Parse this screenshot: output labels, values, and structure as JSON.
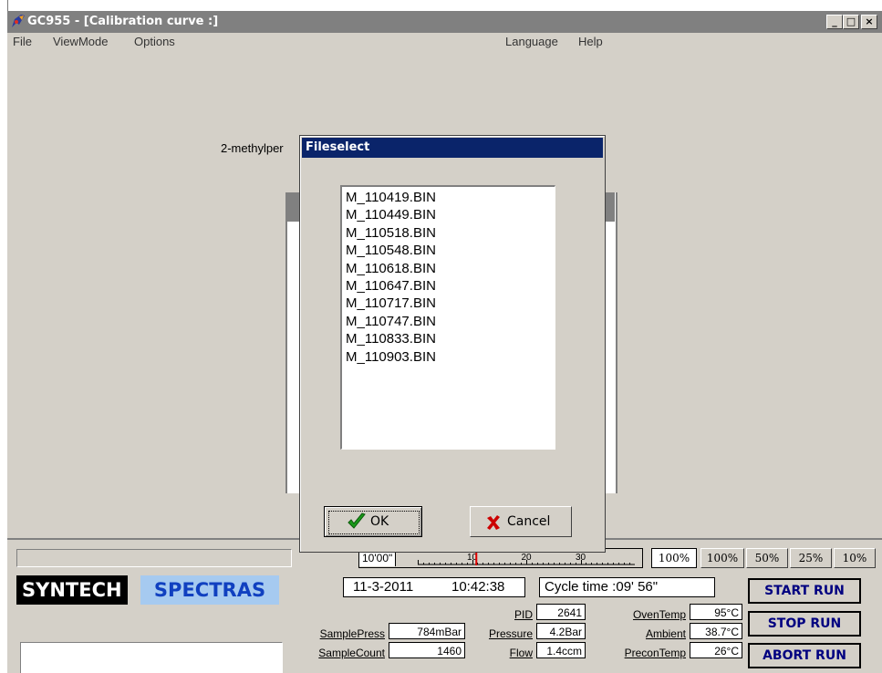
{
  "window": {
    "title": "GC955 - [Calibration curve :]",
    "controls": [
      "_",
      "□",
      "×"
    ]
  },
  "menu": {
    "left": [
      "File",
      "ViewMode",
      "Options"
    ],
    "right": [
      "Language",
      "Help"
    ]
  },
  "background": {
    "compound_label": "2-methylper"
  },
  "dialog": {
    "title": "Fileselect",
    "files": [
      "M_110419.BIN",
      "M_110449.BIN",
      "M_110518.BIN",
      "M_110548.BIN",
      "M_110618.BIN",
      "M_110647.BIN",
      "M_110717.BIN",
      "M_110747.BIN",
      "M_110833.BIN",
      "M_110903.BIN"
    ],
    "ok_label": "OK",
    "cancel_label": "Cancel"
  },
  "timeline": {
    "start": "10'00\"",
    "ticks": [
      "10",
      "20",
      "30"
    ],
    "progress_marker": 0.27
  },
  "zoom": {
    "current": "100%",
    "options": [
      "100%",
      "50%",
      "25%",
      "10%"
    ]
  },
  "brand": {
    "syntech": "SYNTECH",
    "spectras": "SPECTRAS"
  },
  "status": {
    "date": "11-3-2011",
    "time": "10:42:38",
    "cycle_time": "Cycle time :09' 56\""
  },
  "readings": {
    "pid_label": "PID",
    "pid": "2641",
    "oventemp_label": "OvenTemp",
    "oventemp": "95°C",
    "samplepress_label": "SamplePress",
    "samplepress": "784mBar",
    "pressure_label": "Pressure",
    "pressure": "4.2Bar",
    "ambient_label": "Ambient",
    "ambient": "38.7°C",
    "samplecount_label": "SampleCount",
    "samplecount": "1460",
    "flow_label": "Flow",
    "flow": "1.4ccm",
    "precontemp_label": "PreconTemp",
    "precontemp": "26°C"
  },
  "run_buttons": {
    "start": "START RUN",
    "stop": "STOP RUN",
    "abort": "ABORT RUN"
  },
  "colors": {
    "title_inactive": "#808080",
    "dialog_title": "#0a246a",
    "spectras_bg": "#a6caf0",
    "spectras_text": "#1040c0",
    "marker": "#e00000",
    "ok_check": "#1a9a1a",
    "cancel_x": "#cc0000"
  }
}
